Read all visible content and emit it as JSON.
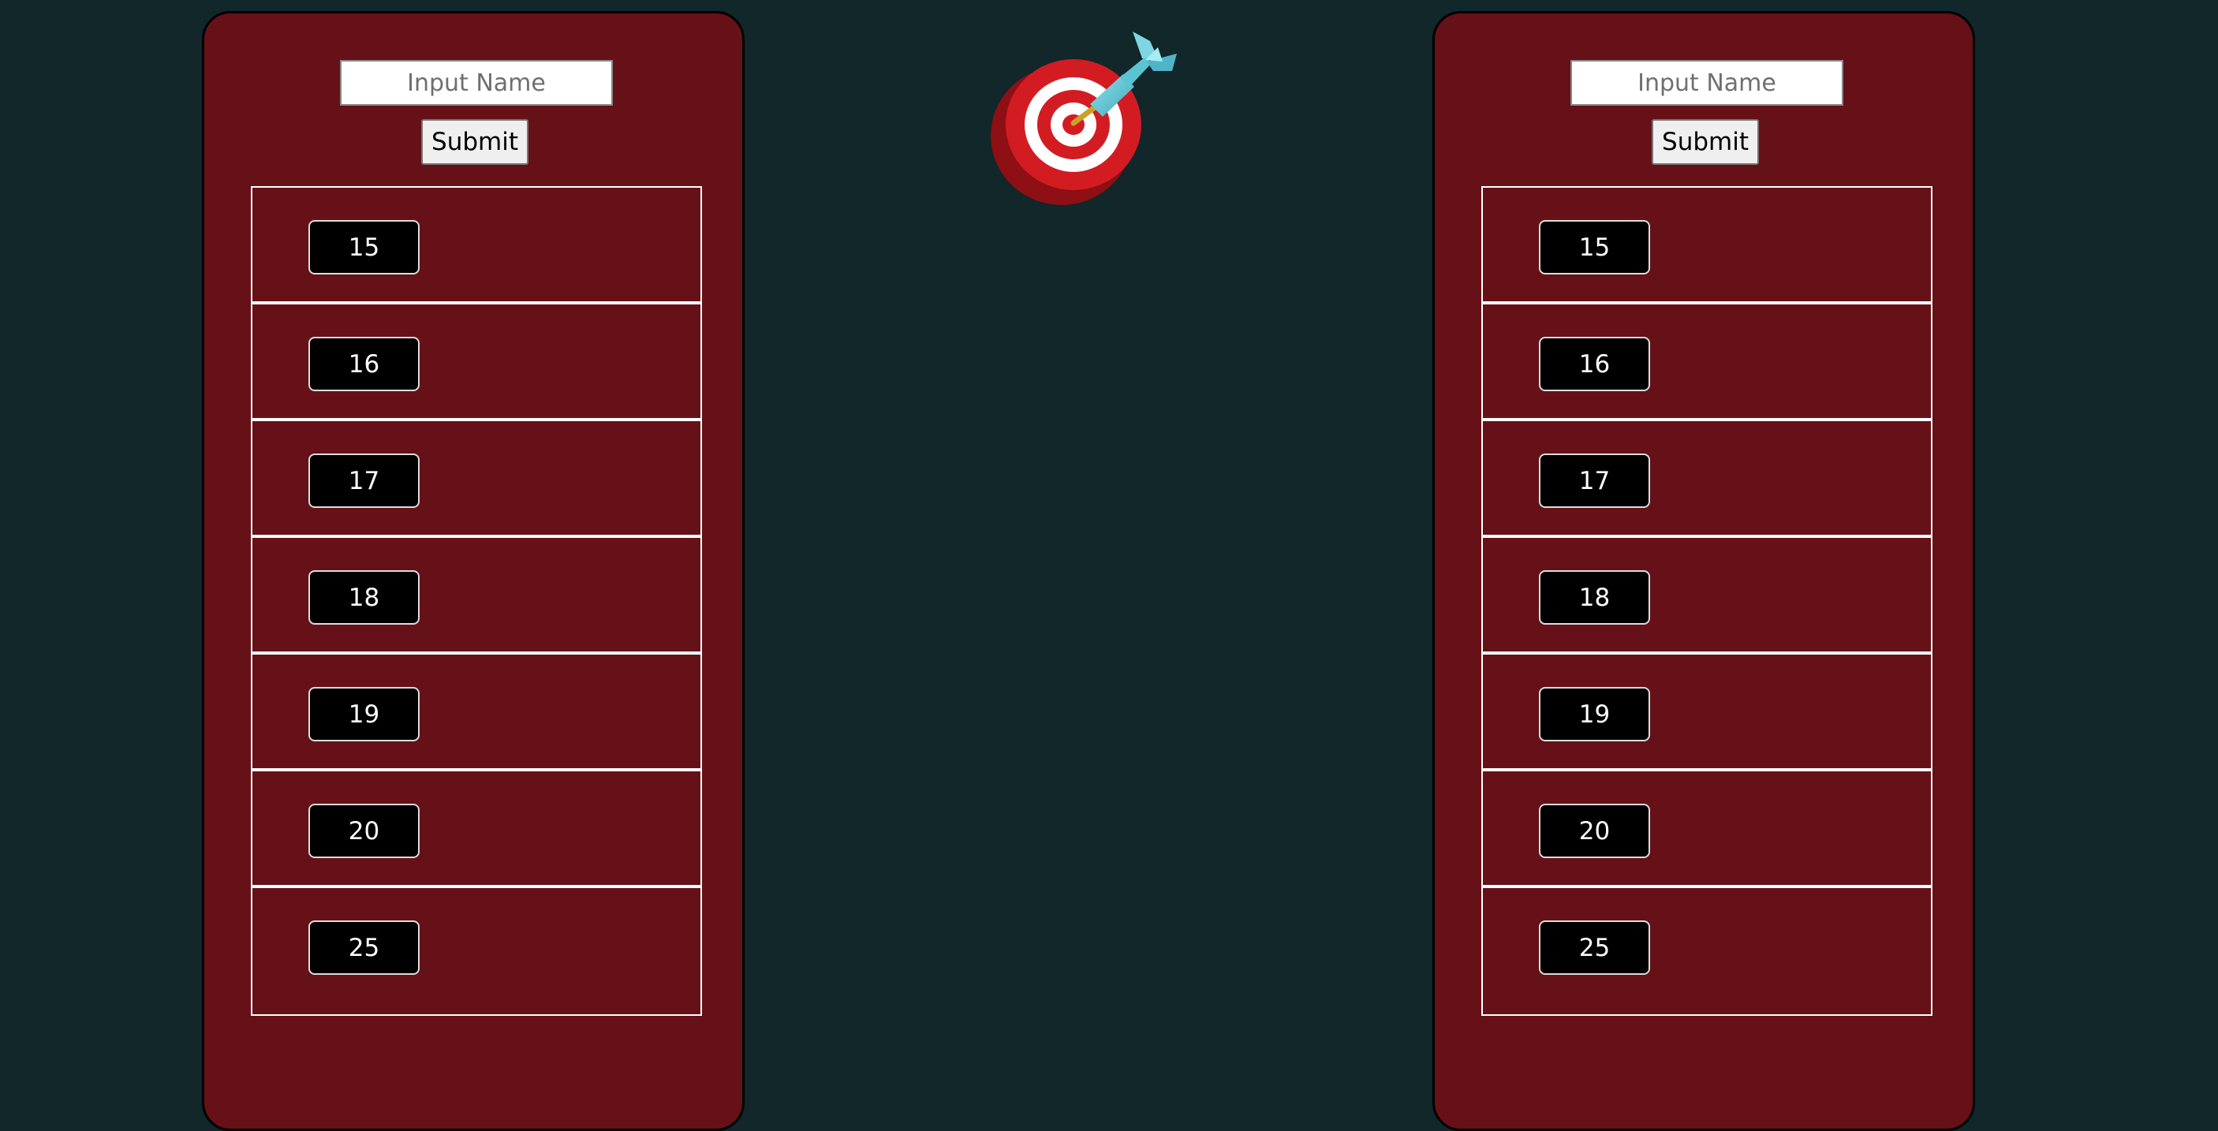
{
  "players": [
    {
      "name_placeholder": "Input Name",
      "submit_label": "Submit",
      "scores": [
        "15",
        "16",
        "17",
        "18",
        "19",
        "20",
        "25"
      ]
    },
    {
      "name_placeholder": "Input Name",
      "submit_label": "Submit",
      "scores": [
        "15",
        "16",
        "17",
        "18",
        "19",
        "20",
        "25"
      ]
    }
  ],
  "center_icon": "dart-target-icon",
  "colors": {
    "background": "#11272a",
    "panel": "#661118",
    "badge": "#000000"
  }
}
